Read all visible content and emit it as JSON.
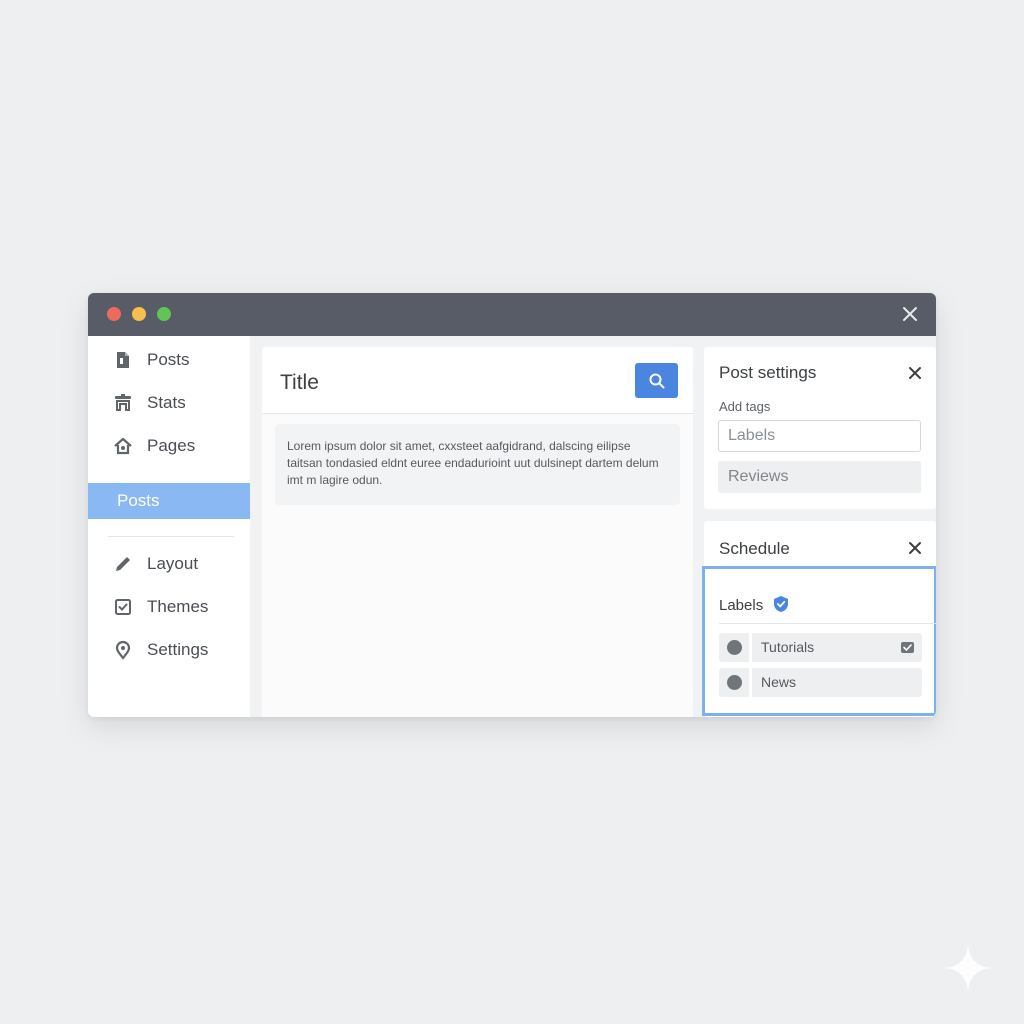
{
  "window": {
    "controls": [
      "close",
      "minimize",
      "maximize"
    ],
    "close_icon": "close-icon"
  },
  "sidebar": {
    "items": [
      {
        "label": "Posts",
        "icon": "document-icon"
      },
      {
        "label": "Stats",
        "icon": "stats-icon"
      },
      {
        "label": "Pages",
        "icon": "home-icon"
      },
      {
        "label": "Posts",
        "active": true
      },
      {
        "label": "Layout",
        "icon": "pencil-icon"
      },
      {
        "label": "Themes",
        "icon": "checkbox-icon"
      },
      {
        "label": "Settings",
        "icon": "location-pin-icon"
      }
    ]
  },
  "main": {
    "title": "Title",
    "search_icon": "search-icon",
    "excerpt": "Lorem ipsum dolor sit amet, cxxsteet  aafgidrand, dalscing eilipse taitsan tondasied eldnt euree endadurioint uut dulsinept dartem delum imt m lagire odun."
  },
  "post_settings": {
    "title": "Post settings",
    "add_tags_label": "Add tags",
    "labels_placeholder": "Labels",
    "reviews_chip": "Reviews"
  },
  "schedule": {
    "title": "Schedule",
    "labels_title": "Labels",
    "labels": [
      {
        "name": "Tutorials"
      },
      {
        "name": "News"
      }
    ]
  },
  "colors": {
    "accent": "#4a86e0",
    "active_nav": "#8ab8f3",
    "titlebar": "#575c66",
    "highlight_border": "#7fb0ee"
  }
}
